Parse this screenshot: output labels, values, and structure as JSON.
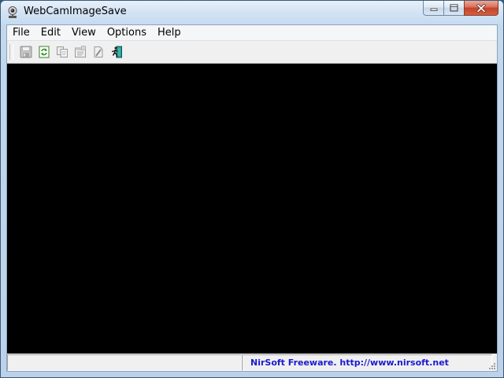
{
  "window": {
    "title": "WebCamImageSave",
    "icon": "webcam-icon"
  },
  "caption_buttons": [
    "minimize-icon",
    "maximize-icon",
    "close-icon"
  ],
  "menu": {
    "items": [
      {
        "label": "File"
      },
      {
        "label": "Edit"
      },
      {
        "label": "View"
      },
      {
        "label": "Options"
      },
      {
        "label": "Help"
      }
    ]
  },
  "toolbar": {
    "buttons": [
      {
        "icon": "save-icon",
        "enabled": false
      },
      {
        "icon": "refresh-icon",
        "enabled": true
      },
      {
        "icon": "copy-icon",
        "enabled": false
      },
      {
        "icon": "properties-icon",
        "enabled": false
      },
      {
        "icon": "options-icon",
        "enabled": false
      },
      {
        "icon": "exit-icon",
        "enabled": true
      }
    ]
  },
  "status": {
    "left": "",
    "right": "NirSoft Freeware.  http://www.nirsoft.net"
  },
  "colors": {
    "viewport": "#000000",
    "status_link": "#1a1ad0"
  }
}
